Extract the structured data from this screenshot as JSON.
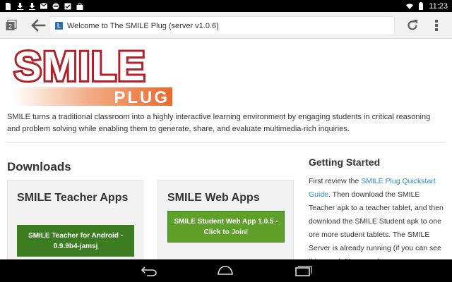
{
  "status_bar": {
    "time": "11:23",
    "notification_icons": [
      "sim-card-icon",
      "download-icon",
      "download-icon",
      "gmail-icon",
      "headset-icon",
      "checkmark-clipboard-icon",
      "bag-icon"
    ],
    "system_icons": [
      "wifi-icon",
      "battery-icon"
    ]
  },
  "browser": {
    "tab_count": "2",
    "page_title": "Welcome to The SMILE Plug (server v1.0.6)",
    "favicon_letter": "L"
  },
  "logo": {
    "word": "SMILE",
    "sub": "PLUG",
    "colors": {
      "word": "#b2202a",
      "sub_bar": "#e9692c"
    }
  },
  "intro": "SMILE turns a traditional classroom into a highly interactive learning environment by engaging students in critical reasoning and problem solving while enabling them to generate, share, and evaluate multimedia-rich inquiries.",
  "downloads": {
    "heading": "Downloads",
    "cards": [
      {
        "title": "SMILE Teacher Apps",
        "button": "SMILE Teacher for Android - 0.9.9b4-jamsj"
      },
      {
        "title": "SMILE Web Apps",
        "button": "SMILE Student Web App 1.0.5 - Click to Join!"
      }
    ]
  },
  "getting_started": {
    "heading": "Getting Started",
    "text_before": "First review the ",
    "link": "SMILE Plug Quickstart Guide",
    "text_after": ". Then download the SMILE Teacher apk to a teacher tablet, and then download the SMILE Student apk to one ore more student tablets. The SMILE Server is already running (if you can see this page). You can always"
  },
  "colors": {
    "link": "#2e8ec9",
    "button_dark_green": "#3d7d22",
    "button_green": "#5ea02a"
  }
}
